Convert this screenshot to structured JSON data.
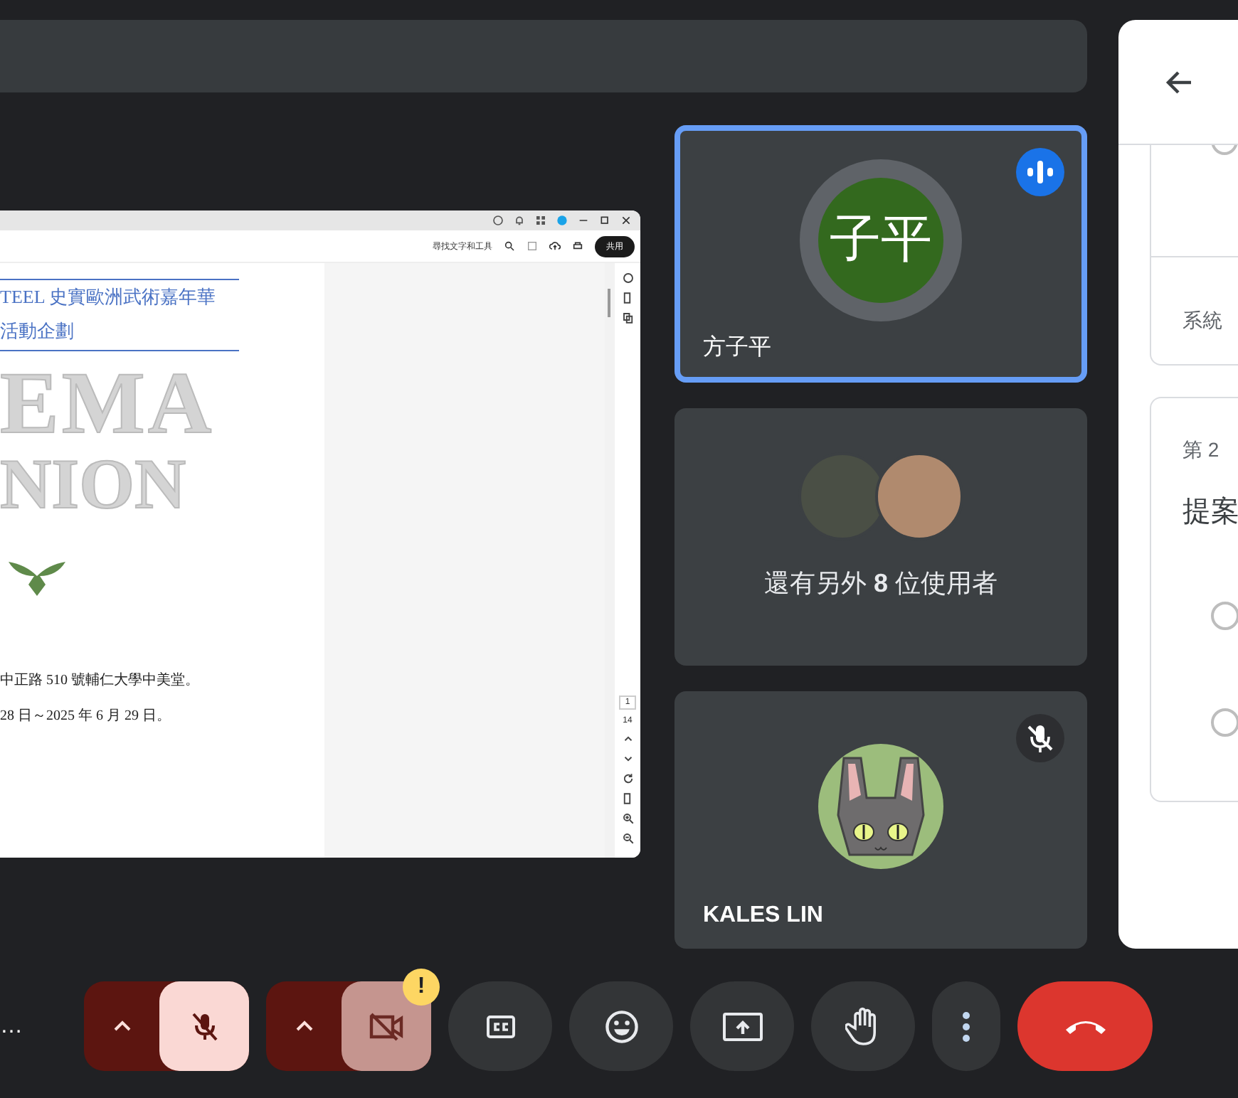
{
  "presentation": {
    "toolbar": {
      "search_label": "尋找文字和工具",
      "share_button": "共用"
    },
    "document": {
      "heading_lines": [
        "TEEL 史實歐洲武術嘉年華",
        "活動企劃"
      ],
      "logo_lines": [
        "EMA",
        "NION"
      ],
      "body_lines": [
        "中正路 510 號輔仁大學中美堂。",
        "28 日～2025 年 6 月 29 日。"
      ]
    },
    "page_rail": {
      "current_page": "1",
      "total_pages": "14"
    }
  },
  "participants": [
    {
      "kind": "initials",
      "initials": "子平",
      "name": "方子平",
      "speaking": true,
      "muted": false
    },
    {
      "kind": "others",
      "text": "還有另外 **8** 位使用者"
    },
    {
      "kind": "image",
      "name": "KALES LIN",
      "speaking": false,
      "muted": true
    }
  ],
  "side_panel": {
    "cards": [
      {
        "kind": "options_end",
        "options": [
          {
            "selected": false
          }
        ],
        "footer": "系統"
      },
      {
        "kind": "question",
        "label": "第 2",
        "title": "提案",
        "options": [
          {
            "selected": false
          },
          {
            "selected": false
          }
        ]
      }
    ]
  },
  "controls": {
    "meeting_name": "…",
    "mic_muted": true,
    "camera_off": true,
    "camera_warning": "!"
  }
}
